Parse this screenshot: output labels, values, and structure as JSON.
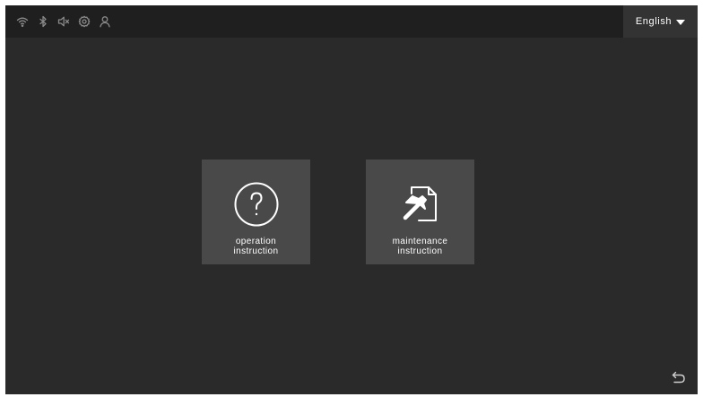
{
  "status_bar": {
    "icons": [
      "wifi-icon",
      "bluetooth-icon",
      "speaker-muted-icon",
      "settings-icon",
      "user-icon"
    ]
  },
  "language": {
    "selected": "English",
    "icon": "caret-down-icon"
  },
  "cards": [
    {
      "icon": "question-circle-icon",
      "label_line1": "operation",
      "label_line2": "instruction"
    },
    {
      "icon": "hammer-document-icon",
      "label_line1": "maintenance",
      "label_line2": "instruction"
    }
  ],
  "back": {
    "icon": "back-arrow-icon"
  },
  "colors": {
    "screen_bg": "#2a2a2a",
    "status_bar_bg": "#1f1f1f",
    "language_bg": "#333333",
    "card_bg": "#494949",
    "text": "#ffffff",
    "status_icon": "#8a8a8a"
  }
}
